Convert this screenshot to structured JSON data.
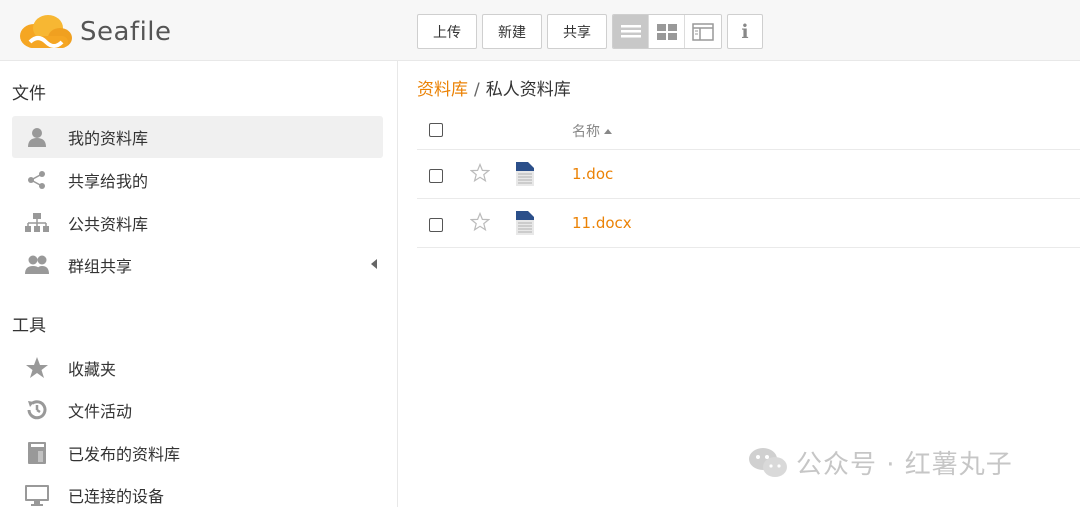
{
  "app": {
    "logo_text": "Seafile",
    "accent": "#eb8205"
  },
  "toolbar": {
    "upload_label": "上传",
    "new_label": "新建",
    "share_label": "共享",
    "view_modes": [
      "list-view-icon",
      "grid-view-icon",
      "column-view-icon"
    ],
    "active_view": "list-view-icon",
    "info_label": "i"
  },
  "sidebar": {
    "files_heading": "文件",
    "files_items": [
      {
        "label": "我的资料库",
        "icon": "user-icon",
        "active": true
      },
      {
        "label": "共享给我的",
        "icon": "share-icon",
        "active": false
      },
      {
        "label": "公共资料库",
        "icon": "org-icon",
        "active": false
      },
      {
        "label": "群组共享",
        "icon": "group-icon",
        "active": false
      }
    ],
    "tools_heading": "工具",
    "tools_items": [
      {
        "label": "收藏夹",
        "icon": "star-icon"
      },
      {
        "label": "文件活动",
        "icon": "history-icon"
      },
      {
        "label": "已发布的资料库",
        "icon": "book-icon"
      },
      {
        "label": "已连接的设备",
        "icon": "monitor-icon"
      }
    ]
  },
  "breadcrumb": {
    "root": "资料库",
    "separator": "/",
    "current": "私人资料库"
  },
  "table": {
    "name_header": "名称",
    "files": [
      {
        "name": "1.doc",
        "icon": "word-doc-icon"
      },
      {
        "name": "11.docx",
        "icon": "word-doc-icon"
      }
    ]
  },
  "watermark": {
    "text": "公众号 · 红薯丸子"
  }
}
